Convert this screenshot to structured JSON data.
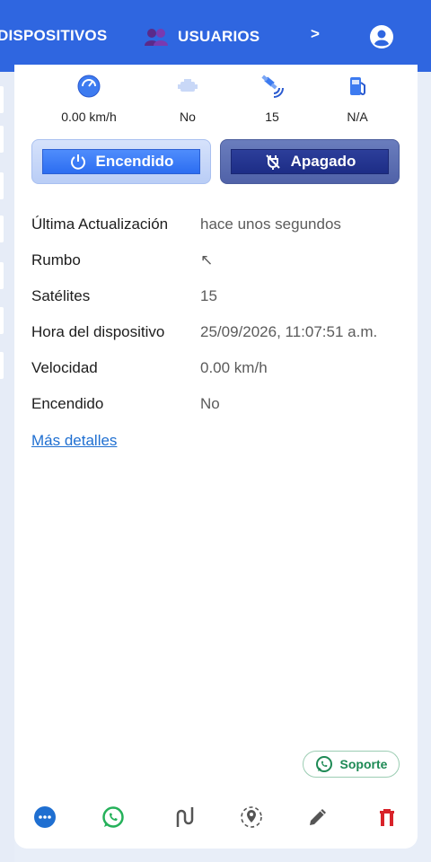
{
  "header": {
    "tab_devices": "DISPOSITIVOS",
    "tab_users": "USUARIOS",
    "next_arrow": ">",
    "bg_color": "#2f66e0",
    "account_icon": "account-circle-icon"
  },
  "stats": [
    {
      "icon": "speedometer-icon",
      "value": "0.00 km/h"
    },
    {
      "icon": "engine-icon",
      "value": "No"
    },
    {
      "icon": "satellite-icon",
      "value": "15"
    },
    {
      "icon": "fuel-icon",
      "value": "N/A"
    }
  ],
  "actions": {
    "on_label": "Encendido",
    "off_label": "Apagado"
  },
  "details": [
    {
      "label": "Última Actualización",
      "value": "hace unos segundos"
    },
    {
      "label": "Rumbo",
      "value": "↖"
    },
    {
      "label": "Satélites",
      "value": "15"
    },
    {
      "label": "Hora del dispositivo",
      "value": "25/09/2026, 11:07:51 a.m."
    },
    {
      "label": "Velocidad",
      "value": "0.00 km/h"
    },
    {
      "label": "Encendido",
      "value": "No"
    }
  ],
  "more_details": "Más detalles",
  "support_label": "Soporte",
  "bottom_icons": [
    "more-icon",
    "whatsapp-icon",
    "route-icon",
    "geofence-icon",
    "edit-icon",
    "delete-icon"
  ]
}
